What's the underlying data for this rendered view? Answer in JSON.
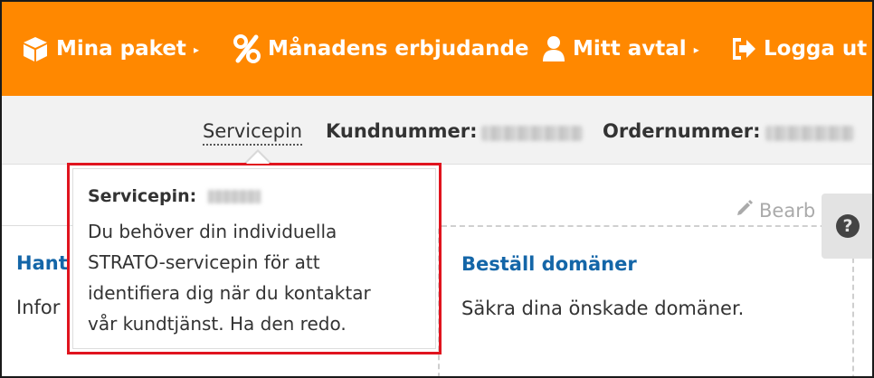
{
  "nav": {
    "packages_label": "Mina paket",
    "offers_label": "Månadens erbjudande",
    "contract_label": "Mitt avtal",
    "logout_label": "Logga ut",
    "caret": "▸"
  },
  "info": {
    "servicepin_link": "Servicepin",
    "customer_label": "Kundnummer:",
    "order_label": "Ordernummer:"
  },
  "tooltip": {
    "heading": "Servicepin:",
    "lines": [
      "Du behöver din individuella",
      "STRATO-servicepin för att",
      "identifiera dig när du kontaktar",
      "vår kundtjänst. Ha den redo."
    ]
  },
  "left_panel": {
    "title": "Hant",
    "text": "Infor"
  },
  "edit_label": "Bearb",
  "card": {
    "title": "Beställ domäner",
    "text": "Säkra dina önskade domäner."
  },
  "help": {
    "icon": "?"
  },
  "colors": {
    "brand": "#ff8800",
    "link": "#1466a8",
    "highlight": "#e0141e"
  }
}
